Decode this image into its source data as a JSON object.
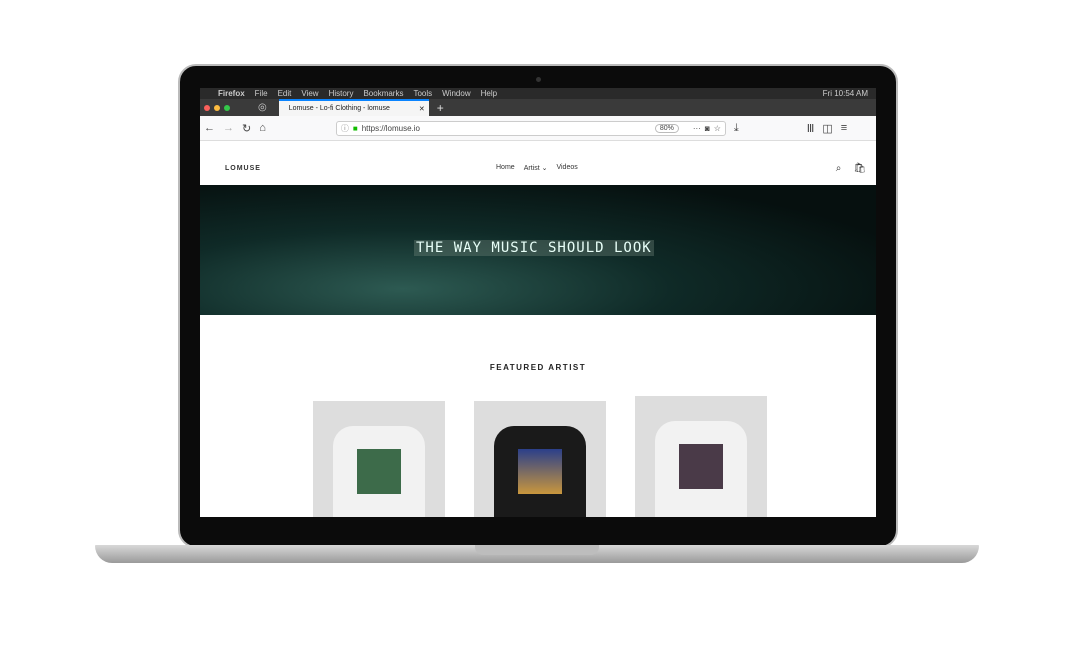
{
  "menubar": {
    "items": [
      "Firefox",
      "File",
      "Edit",
      "View",
      "History",
      "Bookmarks",
      "Tools",
      "Window",
      "Help"
    ],
    "clock": "Fri 10:54 AM"
  },
  "browser": {
    "tab_title": "Lomuse - Lo-fi Clothing - lomuse",
    "new_tab": "+",
    "url": "https://lomuse.io",
    "zoom": "80%"
  },
  "site": {
    "logo": "LOMUSE",
    "nav": [
      "Home",
      "Artist ⌄",
      "Videos"
    ],
    "hero_title": "THE WAY MUSIC SHOULD LOOK",
    "section_title": "FEATURED ARTIST"
  },
  "colors": {
    "accent": "#0a84ff"
  }
}
